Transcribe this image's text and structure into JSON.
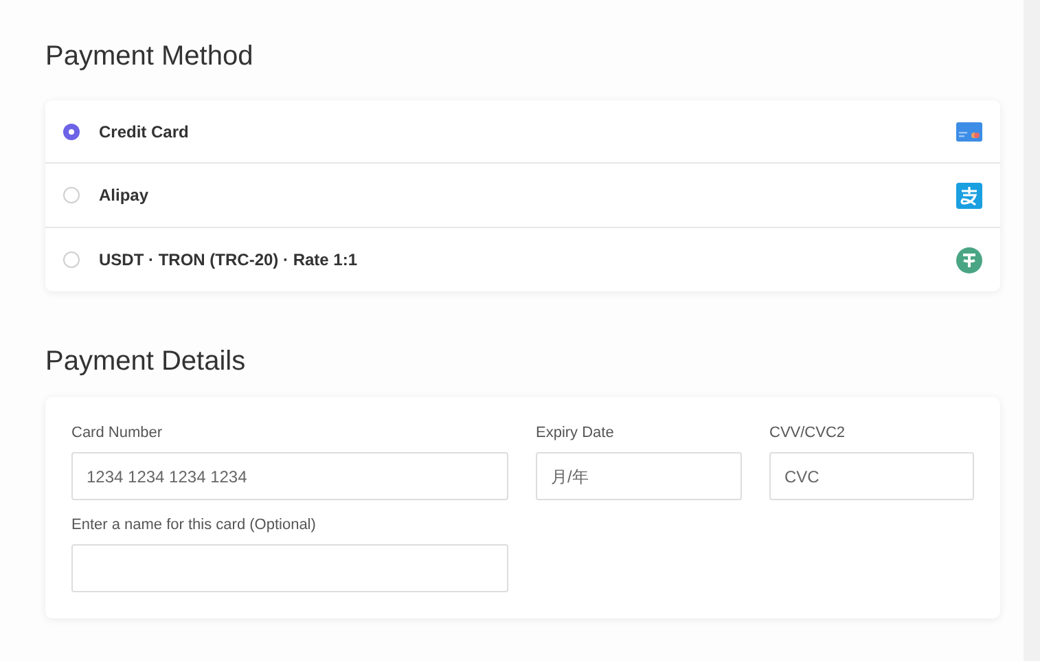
{
  "payment_method": {
    "title": "Payment Method",
    "options": [
      {
        "label": "Credit Card",
        "selected": true,
        "kind": "card"
      },
      {
        "label": "Alipay",
        "selected": false,
        "kind": "alipay"
      },
      {
        "label": "USDT · TRON (TRC-20) · Rate 1:1",
        "selected": false,
        "kind": "tether"
      }
    ]
  },
  "payment_details": {
    "title": "Payment Details",
    "card_number": {
      "label": "Card Number",
      "placeholder": "1234 1234 1234 1234"
    },
    "expiry_date": {
      "label": "Expiry Date",
      "placeholder": "月/年"
    },
    "cvv": {
      "label": "CVV/CVC2",
      "placeholder": "CVC"
    },
    "card_name": {
      "label": "Enter a name for this card (Optional)"
    }
  }
}
